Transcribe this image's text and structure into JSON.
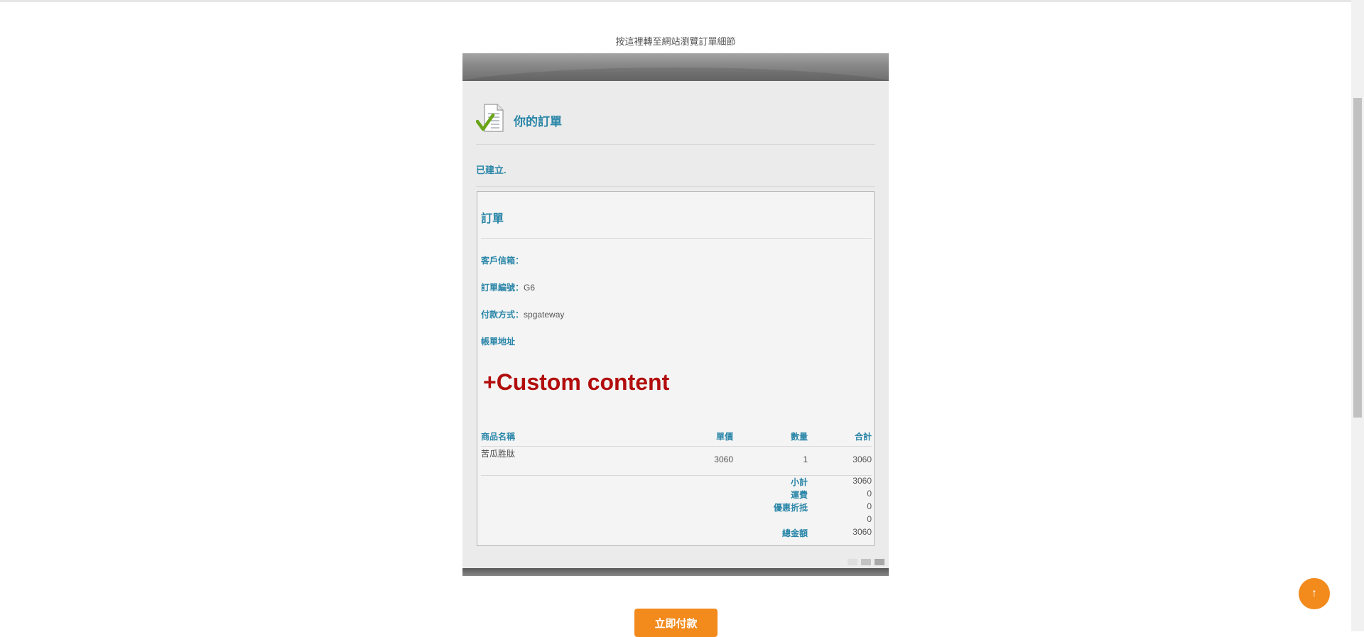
{
  "view_order_link": "按這裡轉至網站瀏覽訂單細節",
  "card": {
    "title": "你的訂單",
    "status": "已建立."
  },
  "order": {
    "heading": "訂單",
    "customer_email_label": "客戶信箱：",
    "customer_email_value": "",
    "order_number_label": "訂單編號：",
    "order_number_value": "G6",
    "payment_method_label": "付款方式：",
    "payment_method_value": "spgateway",
    "billing_address_label": "帳單地址",
    "custom_content": "+Custom content",
    "table": {
      "headers": [
        "商品名稱",
        "單價",
        "數量",
        "合計"
      ],
      "rows": [
        {
          "name": "苦瓜胜肽",
          "unit_price": "3060",
          "quantity": "1",
          "total": "3060"
        }
      ]
    },
    "totals": [
      {
        "label": "小計",
        "value": "3060"
      },
      {
        "label": "運費",
        "value": "0"
      },
      {
        "label": "優惠折抵",
        "value": "0"
      },
      {
        "label": "",
        "value": "0"
      },
      {
        "label": "總金額",
        "value": "3060"
      }
    ]
  },
  "pay_button_label": "立即付款",
  "scroll_top_glyph": "↑",
  "colors": {
    "accent": "#2a86a8",
    "custom_content": "#b20d0d",
    "button": "#f28a1c"
  }
}
